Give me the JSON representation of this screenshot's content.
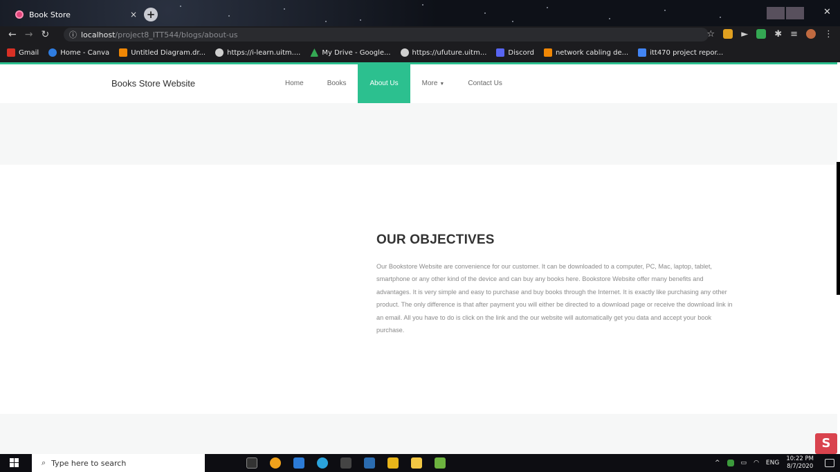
{
  "browser": {
    "tab_title": "Book Store",
    "tab_close": "×",
    "new_tab": "+",
    "url_host": "localhost",
    "url_path": "/project8_ITT544/blogs/about-us",
    "bookmarks": [
      {
        "label": "Gmail",
        "color": "#d93025"
      },
      {
        "label": "Home - Canva",
        "color": "#2f7de1"
      },
      {
        "label": "Untitled Diagram.dr...",
        "color": "#f08705"
      },
      {
        "label": "https://i-learn.uitm....",
        "color": "#cfcfcf"
      },
      {
        "label": "My Drive - Google...",
        "color": "#34a853"
      },
      {
        "label": "https://ufuture.uitm...",
        "color": "#cfcfcf"
      },
      {
        "label": "Discord",
        "color": "#5865f2"
      },
      {
        "label": "network cabling de...",
        "color": "#f08705"
      },
      {
        "label": "itt470 project repor...",
        "color": "#4285f4"
      }
    ]
  },
  "site": {
    "brand": "Books Store Website",
    "nav": {
      "home": "Home",
      "books": "Books",
      "about": "About Us",
      "more": "More",
      "contact": "Contact Us"
    },
    "accent_color": "#2cc08f"
  },
  "objectives": {
    "title": "OUR OBJECTIVES",
    "body": "Our Bookstore Website are convenience for our customer. It can be downloaded to a computer, PC, Mac, laptop, tablet, smartphone or any other kind of the device and can buy any books here. Bookstore Website offer many benefits and advantages. It is very simple and easy to purchase and buy books through the Internet. It is exactly like purchasing any other product. The only difference is that after payment you will either be directed to a download page or receive the download link in an email. All you have to do is click on the link and the our website will automatically get you data and accept your book purchase."
  },
  "taskbar": {
    "search_placeholder": "Type here to search",
    "lang": "ENG",
    "time": "10:22 PM",
    "date": "8/7/2020"
  }
}
